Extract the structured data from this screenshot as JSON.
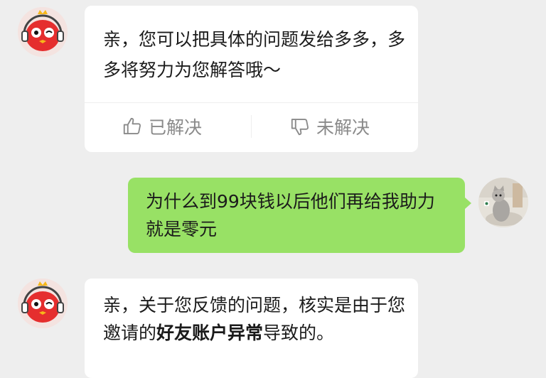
{
  "messages": [
    {
      "sender": "bot",
      "text": "亲，您可以把具体的问题发给多多，多多将努力为您解答哦～",
      "feedback": {
        "solved_label": "已解决",
        "unsolved_label": "未解决"
      }
    },
    {
      "sender": "user",
      "text": "为什么到99块钱以后他们再给我助力就是零元"
    },
    {
      "sender": "bot",
      "text_before": "亲，关于您反馈的问题，核实是由于您邀请的",
      "text_bold": "好友账户异常",
      "text_after": "导致的。"
    }
  ],
  "colors": {
    "user_bubble": "#98e165",
    "bot_bubble": "#ffffff",
    "background": "#eeeeee",
    "bot_avatar_red": "#e52e2e"
  }
}
